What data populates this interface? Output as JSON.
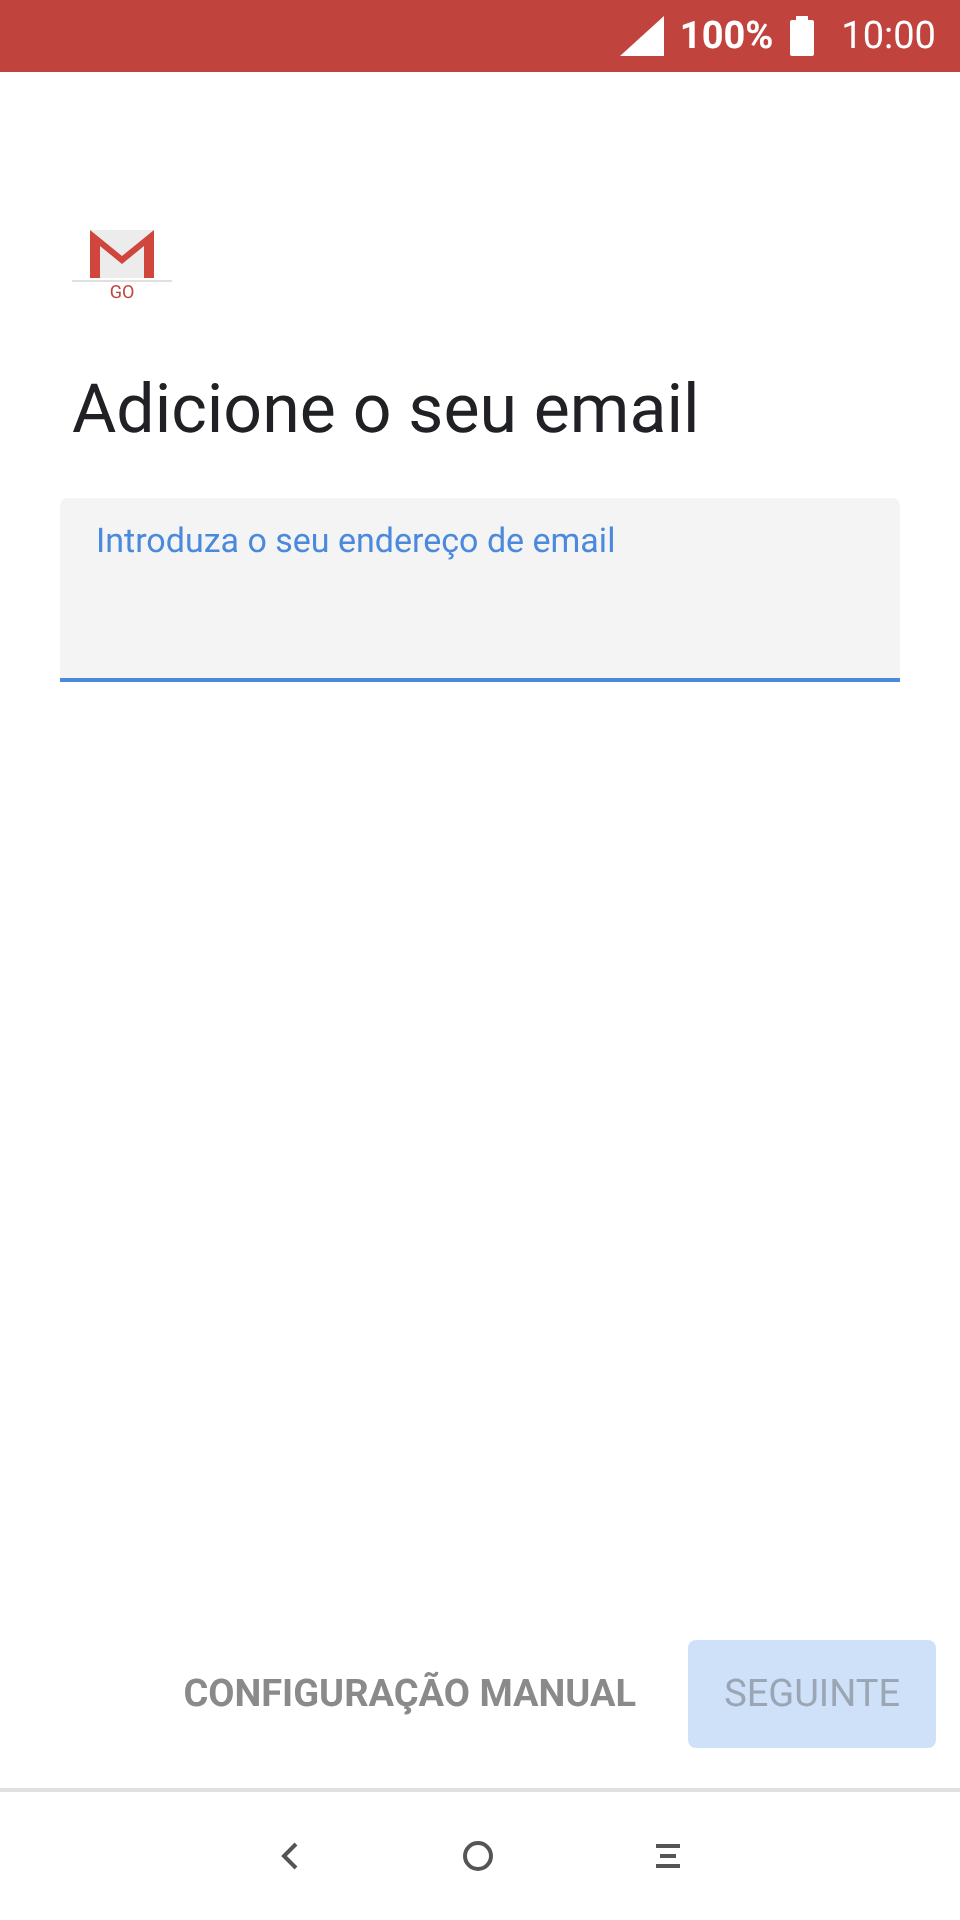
{
  "status_bar": {
    "battery": "100%",
    "time": "10:00"
  },
  "logo": {
    "text": "GO"
  },
  "title": "Adicione o seu email",
  "email_field": {
    "placeholder": "Introduza o seu endereço de email",
    "focused": true
  },
  "buttons": [
    {
      "label": "CONFIGURAÇÃO MANUAL",
      "kind": "text",
      "disabled": false
    },
    {
      "label": "SEGUINTE",
      "kind": "filled",
      "disabled": true
    }
  ]
}
